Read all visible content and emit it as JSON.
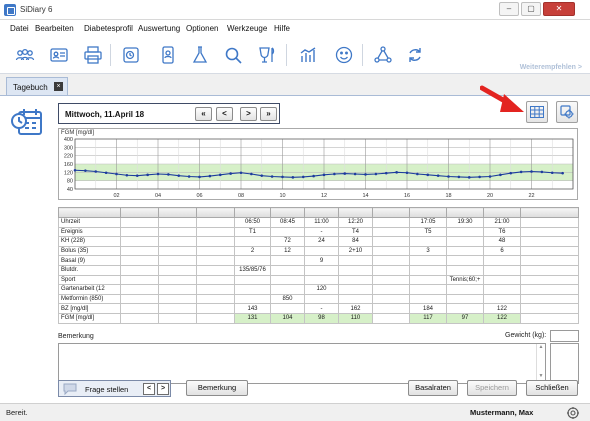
{
  "window": {
    "title": "SiDiary 6",
    "minimize": "–",
    "maximize": "▢",
    "close": "✕"
  },
  "menu": [
    "Datei",
    "Bearbeiten",
    "Diabetesprofil",
    "Auswertung",
    "Optionen",
    "Werkzeuge",
    "Hilfe"
  ],
  "toolbar": {
    "recommend": "Weiterempfehlen >"
  },
  "tab": {
    "label": "Tagebuch",
    "close": "×"
  },
  "datebar": {
    "date": "Mittwoch, 11.April 18",
    "first": "«",
    "prev": "<",
    "next": ">",
    "last": "»"
  },
  "chart_data": {
    "type": "line",
    "ylabel": "FGM [mg/dl]",
    "y_ticks": [
      400,
      300,
      220,
      160,
      120,
      80,
      40
    ],
    "x_ticks": [
      "02",
      "04",
      "06",
      "08",
      "10",
      "12",
      "14",
      "16",
      "18",
      "20",
      "22"
    ],
    "xlim": [
      0,
      24
    ],
    "target_range": [
      80,
      160
    ],
    "series": [
      {
        "x": [
          0,
          0.5,
          1,
          1.5,
          2,
          2.5,
          3,
          3.5,
          4,
          4.5,
          5,
          5.5,
          6,
          6.5,
          7,
          7.5,
          8,
          8.5,
          9,
          9.5,
          10,
          10.5,
          11,
          11.5,
          12,
          12.5,
          13,
          13.5,
          14,
          14.5,
          15,
          15.5,
          16,
          16.5,
          17,
          17.5,
          18,
          18.5,
          19,
          19.5,
          20,
          20.5,
          21,
          21.5,
          22,
          22.5,
          23,
          23.5
        ],
        "values": [
          130,
          128,
          124,
          118,
          112,
          106,
          104,
          108,
          112,
          110,
          104,
          100,
          98,
          102,
          108,
          114,
          118,
          112,
          104,
          100,
          98,
          96,
          98,
          102,
          108,
          112,
          114,
          112,
          110,
          112,
          116,
          120,
          118,
          112,
          108,
          104,
          100,
          98,
          96,
          98,
          100,
          108,
          116,
          122,
          124,
          122,
          118,
          116
        ]
      }
    ]
  },
  "grid": {
    "header": [
      "",
      "",
      "",
      "",
      "",
      "",
      "",
      "",
      "",
      "",
      "",
      "",
      ""
    ],
    "rows": [
      {
        "label": "Uhrzeit",
        "cells": [
          "",
          "",
          "",
          "06:50",
          "08:45",
          "11:00",
          "12:20",
          "",
          "17:05",
          "19:30",
          "21:00",
          ""
        ]
      },
      {
        "label": "Ereignis",
        "cells": [
          "",
          "",
          "",
          "T1",
          "",
          "-",
          "T4",
          "",
          "T5",
          "",
          "T6",
          ""
        ]
      },
      {
        "label": "KH (228)",
        "cells": [
          "",
          "",
          "",
          "",
          "72",
          "24",
          "84",
          "",
          "",
          "",
          "48",
          ""
        ]
      },
      {
        "label": "Bolus (35)",
        "cells": [
          "",
          "",
          "",
          "2",
          "12",
          "",
          "2+10",
          "",
          "3",
          "",
          "6",
          ""
        ]
      },
      {
        "label": "Basal (9)",
        "cells": [
          "",
          "",
          "",
          "",
          "",
          "9",
          "",
          "",
          "",
          "",
          "",
          ""
        ]
      },
      {
        "label": "Blutdr.",
        "cells": [
          "",
          "",
          "",
          "135/85/76",
          "",
          "",
          "",
          "",
          "",
          "",
          "",
          ""
        ]
      },
      {
        "label": "Sport",
        "cells": [
          "",
          "",
          "",
          "",
          "",
          "",
          "",
          "",
          "",
          "Tennis;60;+",
          "",
          ""
        ]
      },
      {
        "label": "Gartenarbeit (12",
        "cells": [
          "",
          "",
          "",
          "",
          "",
          "120",
          "",
          "",
          "",
          "",
          "",
          ""
        ]
      },
      {
        "label": "Metformin (850)",
        "cells": [
          "",
          "",
          "",
          "",
          "850",
          "",
          "",
          "",
          "",
          "",
          "",
          ""
        ]
      },
      {
        "label": "BZ [mg/dl]",
        "cells": [
          "",
          "",
          "",
          "143",
          "",
          "-",
          "162",
          "",
          "184",
          "",
          "122",
          ""
        ]
      },
      {
        "label": "FGM [mg/dl]",
        "cells": [
          "",
          "",
          "",
          "131",
          "104",
          "98",
          "110",
          "",
          "117",
          "97",
          "122",
          ""
        ]
      }
    ]
  },
  "notes": {
    "label": "Bemerkung",
    "weight_label": "Gewicht (kg):",
    "weight_value": "",
    "scroll_up": "▲",
    "scroll_down": "▼"
  },
  "buttons": {
    "frage": "Frage stellen",
    "frage_prev": "<",
    "frage_next": ">",
    "bemerkung": "Bemerkung",
    "basalraten": "Basalraten",
    "speichern": "Speichern",
    "schliessen": "Schließen"
  },
  "status": {
    "text": "Bereit.",
    "user": "Mustermann, Max"
  },
  "colors": {
    "accent": "#3f78c7",
    "arrow": "#e32420",
    "target_fill": "#d6f0c8",
    "line": "#1d3c9e"
  }
}
